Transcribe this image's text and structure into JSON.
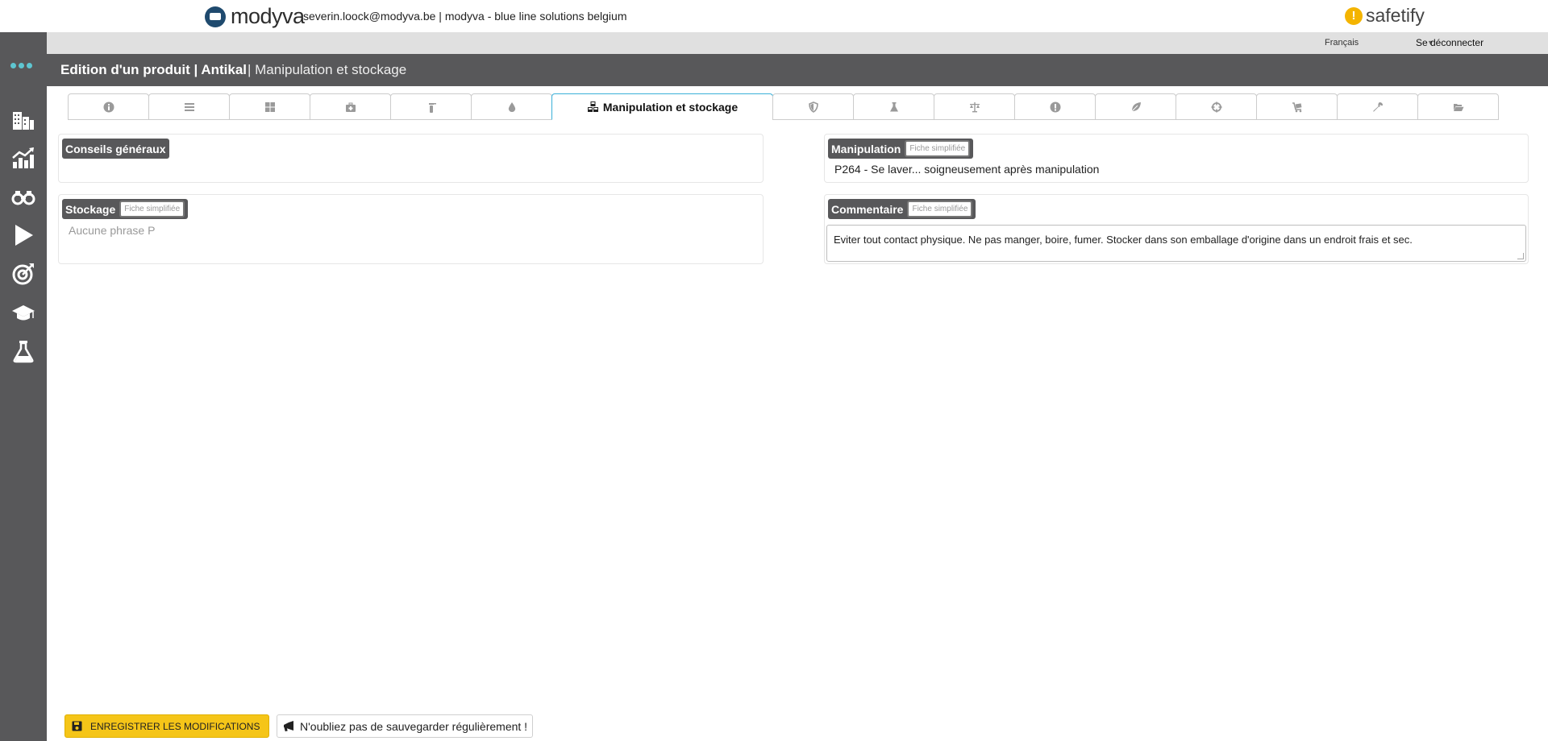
{
  "header": {
    "brand_name": "modyva",
    "user_line": "severin.loock@modyva.be | modyva - blue line solutions belgium",
    "safetify_name": "safetify"
  },
  "langbar": {
    "language": "Français",
    "logout": "Se déconnecter"
  },
  "title": {
    "main": "Edition d'un produit | Antikal",
    "sub": "| Manipulation et stockage"
  },
  "tabs": {
    "active_label": "Manipulation et stockage"
  },
  "panels": {
    "conseils": {
      "label": "Conseils généraux"
    },
    "manipulation": {
      "label": "Manipulation",
      "pill": "Fiche simplifiée",
      "value": "P264 - Se laver... soigneusement après manipulation"
    },
    "stockage": {
      "label": "Stockage",
      "pill": "Fiche simplifiée",
      "value": "Aucune phrase P"
    },
    "commentaire": {
      "label": "Commentaire",
      "pill": "Fiche simplifiée",
      "value": "Eviter tout contact physique. Ne pas manger, boire, fumer. Stocker dans son emballage d'origine dans un endroit frais et sec."
    }
  },
  "footer": {
    "save_label": "ENREGISTRER LES MODIFICATIONS",
    "reminder": "N'oubliez pas de sauvegarder régulièrement !"
  },
  "colors": {
    "sidebar": "#58585a",
    "accent_tab": "#3ab0d8",
    "save_button": "#f5c518",
    "dots": "#5ec6d1"
  }
}
